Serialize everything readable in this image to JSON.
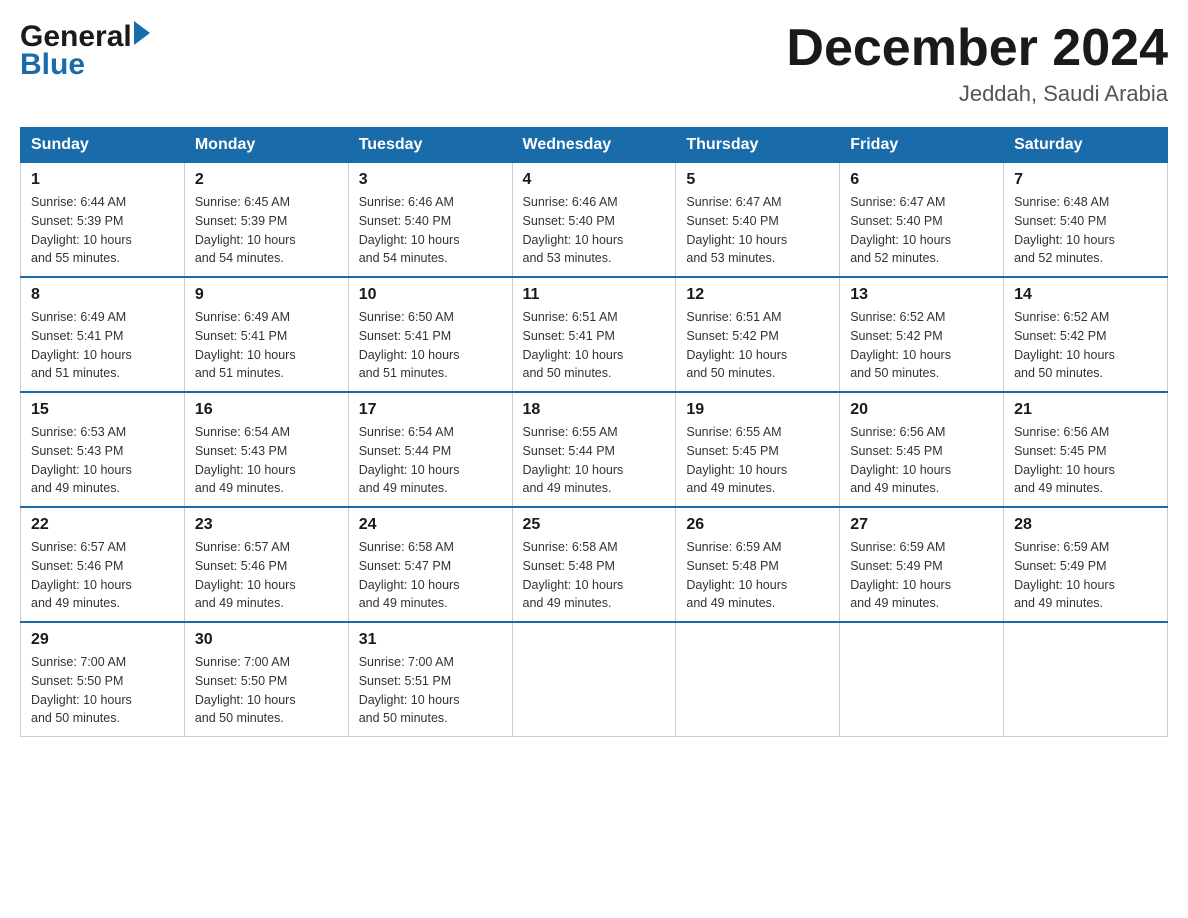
{
  "header": {
    "logo_general": "General",
    "logo_blue": "Blue",
    "month_title": "December 2024",
    "location": "Jeddah, Saudi Arabia"
  },
  "days_of_week": [
    "Sunday",
    "Monday",
    "Tuesday",
    "Wednesday",
    "Thursday",
    "Friday",
    "Saturday"
  ],
  "weeks": [
    [
      {
        "day": "1",
        "sunrise": "6:44 AM",
        "sunset": "5:39 PM",
        "daylight": "10 hours and 55 minutes."
      },
      {
        "day": "2",
        "sunrise": "6:45 AM",
        "sunset": "5:39 PM",
        "daylight": "10 hours and 54 minutes."
      },
      {
        "day": "3",
        "sunrise": "6:46 AM",
        "sunset": "5:40 PM",
        "daylight": "10 hours and 54 minutes."
      },
      {
        "day": "4",
        "sunrise": "6:46 AM",
        "sunset": "5:40 PM",
        "daylight": "10 hours and 53 minutes."
      },
      {
        "day": "5",
        "sunrise": "6:47 AM",
        "sunset": "5:40 PM",
        "daylight": "10 hours and 53 minutes."
      },
      {
        "day": "6",
        "sunrise": "6:47 AM",
        "sunset": "5:40 PM",
        "daylight": "10 hours and 52 minutes."
      },
      {
        "day": "7",
        "sunrise": "6:48 AM",
        "sunset": "5:40 PM",
        "daylight": "10 hours and 52 minutes."
      }
    ],
    [
      {
        "day": "8",
        "sunrise": "6:49 AM",
        "sunset": "5:41 PM",
        "daylight": "10 hours and 51 minutes."
      },
      {
        "day": "9",
        "sunrise": "6:49 AM",
        "sunset": "5:41 PM",
        "daylight": "10 hours and 51 minutes."
      },
      {
        "day": "10",
        "sunrise": "6:50 AM",
        "sunset": "5:41 PM",
        "daylight": "10 hours and 51 minutes."
      },
      {
        "day": "11",
        "sunrise": "6:51 AM",
        "sunset": "5:41 PM",
        "daylight": "10 hours and 50 minutes."
      },
      {
        "day": "12",
        "sunrise": "6:51 AM",
        "sunset": "5:42 PM",
        "daylight": "10 hours and 50 minutes."
      },
      {
        "day": "13",
        "sunrise": "6:52 AM",
        "sunset": "5:42 PM",
        "daylight": "10 hours and 50 minutes."
      },
      {
        "day": "14",
        "sunrise": "6:52 AM",
        "sunset": "5:42 PM",
        "daylight": "10 hours and 50 minutes."
      }
    ],
    [
      {
        "day": "15",
        "sunrise": "6:53 AM",
        "sunset": "5:43 PM",
        "daylight": "10 hours and 49 minutes."
      },
      {
        "day": "16",
        "sunrise": "6:54 AM",
        "sunset": "5:43 PM",
        "daylight": "10 hours and 49 minutes."
      },
      {
        "day": "17",
        "sunrise": "6:54 AM",
        "sunset": "5:44 PM",
        "daylight": "10 hours and 49 minutes."
      },
      {
        "day": "18",
        "sunrise": "6:55 AM",
        "sunset": "5:44 PM",
        "daylight": "10 hours and 49 minutes."
      },
      {
        "day": "19",
        "sunrise": "6:55 AM",
        "sunset": "5:45 PM",
        "daylight": "10 hours and 49 minutes."
      },
      {
        "day": "20",
        "sunrise": "6:56 AM",
        "sunset": "5:45 PM",
        "daylight": "10 hours and 49 minutes."
      },
      {
        "day": "21",
        "sunrise": "6:56 AM",
        "sunset": "5:45 PM",
        "daylight": "10 hours and 49 minutes."
      }
    ],
    [
      {
        "day": "22",
        "sunrise": "6:57 AM",
        "sunset": "5:46 PM",
        "daylight": "10 hours and 49 minutes."
      },
      {
        "day": "23",
        "sunrise": "6:57 AM",
        "sunset": "5:46 PM",
        "daylight": "10 hours and 49 minutes."
      },
      {
        "day": "24",
        "sunrise": "6:58 AM",
        "sunset": "5:47 PM",
        "daylight": "10 hours and 49 minutes."
      },
      {
        "day": "25",
        "sunrise": "6:58 AM",
        "sunset": "5:48 PM",
        "daylight": "10 hours and 49 minutes."
      },
      {
        "day": "26",
        "sunrise": "6:59 AM",
        "sunset": "5:48 PM",
        "daylight": "10 hours and 49 minutes."
      },
      {
        "day": "27",
        "sunrise": "6:59 AM",
        "sunset": "5:49 PM",
        "daylight": "10 hours and 49 minutes."
      },
      {
        "day": "28",
        "sunrise": "6:59 AM",
        "sunset": "5:49 PM",
        "daylight": "10 hours and 49 minutes."
      }
    ],
    [
      {
        "day": "29",
        "sunrise": "7:00 AM",
        "sunset": "5:50 PM",
        "daylight": "10 hours and 50 minutes."
      },
      {
        "day": "30",
        "sunrise": "7:00 AM",
        "sunset": "5:50 PM",
        "daylight": "10 hours and 50 minutes."
      },
      {
        "day": "31",
        "sunrise": "7:00 AM",
        "sunset": "5:51 PM",
        "daylight": "10 hours and 50 minutes."
      },
      null,
      null,
      null,
      null
    ]
  ],
  "labels": {
    "sunrise": "Sunrise:",
    "sunset": "Sunset:",
    "daylight": "Daylight:"
  }
}
